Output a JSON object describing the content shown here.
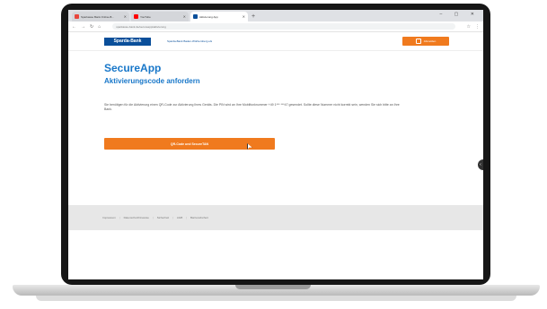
{
  "browser": {
    "tabs": [
      {
        "label": "Sparkasse Bank Online-B...",
        "active": false
      },
      {
        "label": "YouTube",
        "active": false
      },
      {
        "label": "Aktivierung App",
        "active": true
      }
    ],
    "new_tab": "+",
    "window_controls": "– ▢ ✕",
    "url": "sparkasse-bank.de/secureapp/aktivierung",
    "nav": {
      "back": "←",
      "forward": "→",
      "reload": "↻",
      "home": "⌂"
    }
  },
  "site_header": {
    "logo": "Sparda-Bank",
    "link": "Sparda-Bank Baden-Württemberg eG",
    "button": "Abmelden"
  },
  "main": {
    "app_title": "SecureApp",
    "subtitle": "Aktivierungscode anfordern",
    "description": "Sie benötigen für die Aktivierung einen QR-Code zur Aktivierung Ihres Geräts. Die PIN wird an Ihre Mobilfunknummer +49 1*** ***47 gesendet. Sollte diese Nummer nicht korrekt sein, wenden Sie sich bitte an Ihre Bank.",
    "cta": "QR-Code und SecureTAN"
  },
  "footer": {
    "links": [
      "Impressum",
      "Datenschutzhinweise",
      "Sicherheit",
      "AGB",
      "Barrierefreiheit"
    ]
  },
  "colors": {
    "brand_blue": "#0a4f9a",
    "accent_orange": "#f07a1e",
    "heading_blue": "#1877c9"
  }
}
